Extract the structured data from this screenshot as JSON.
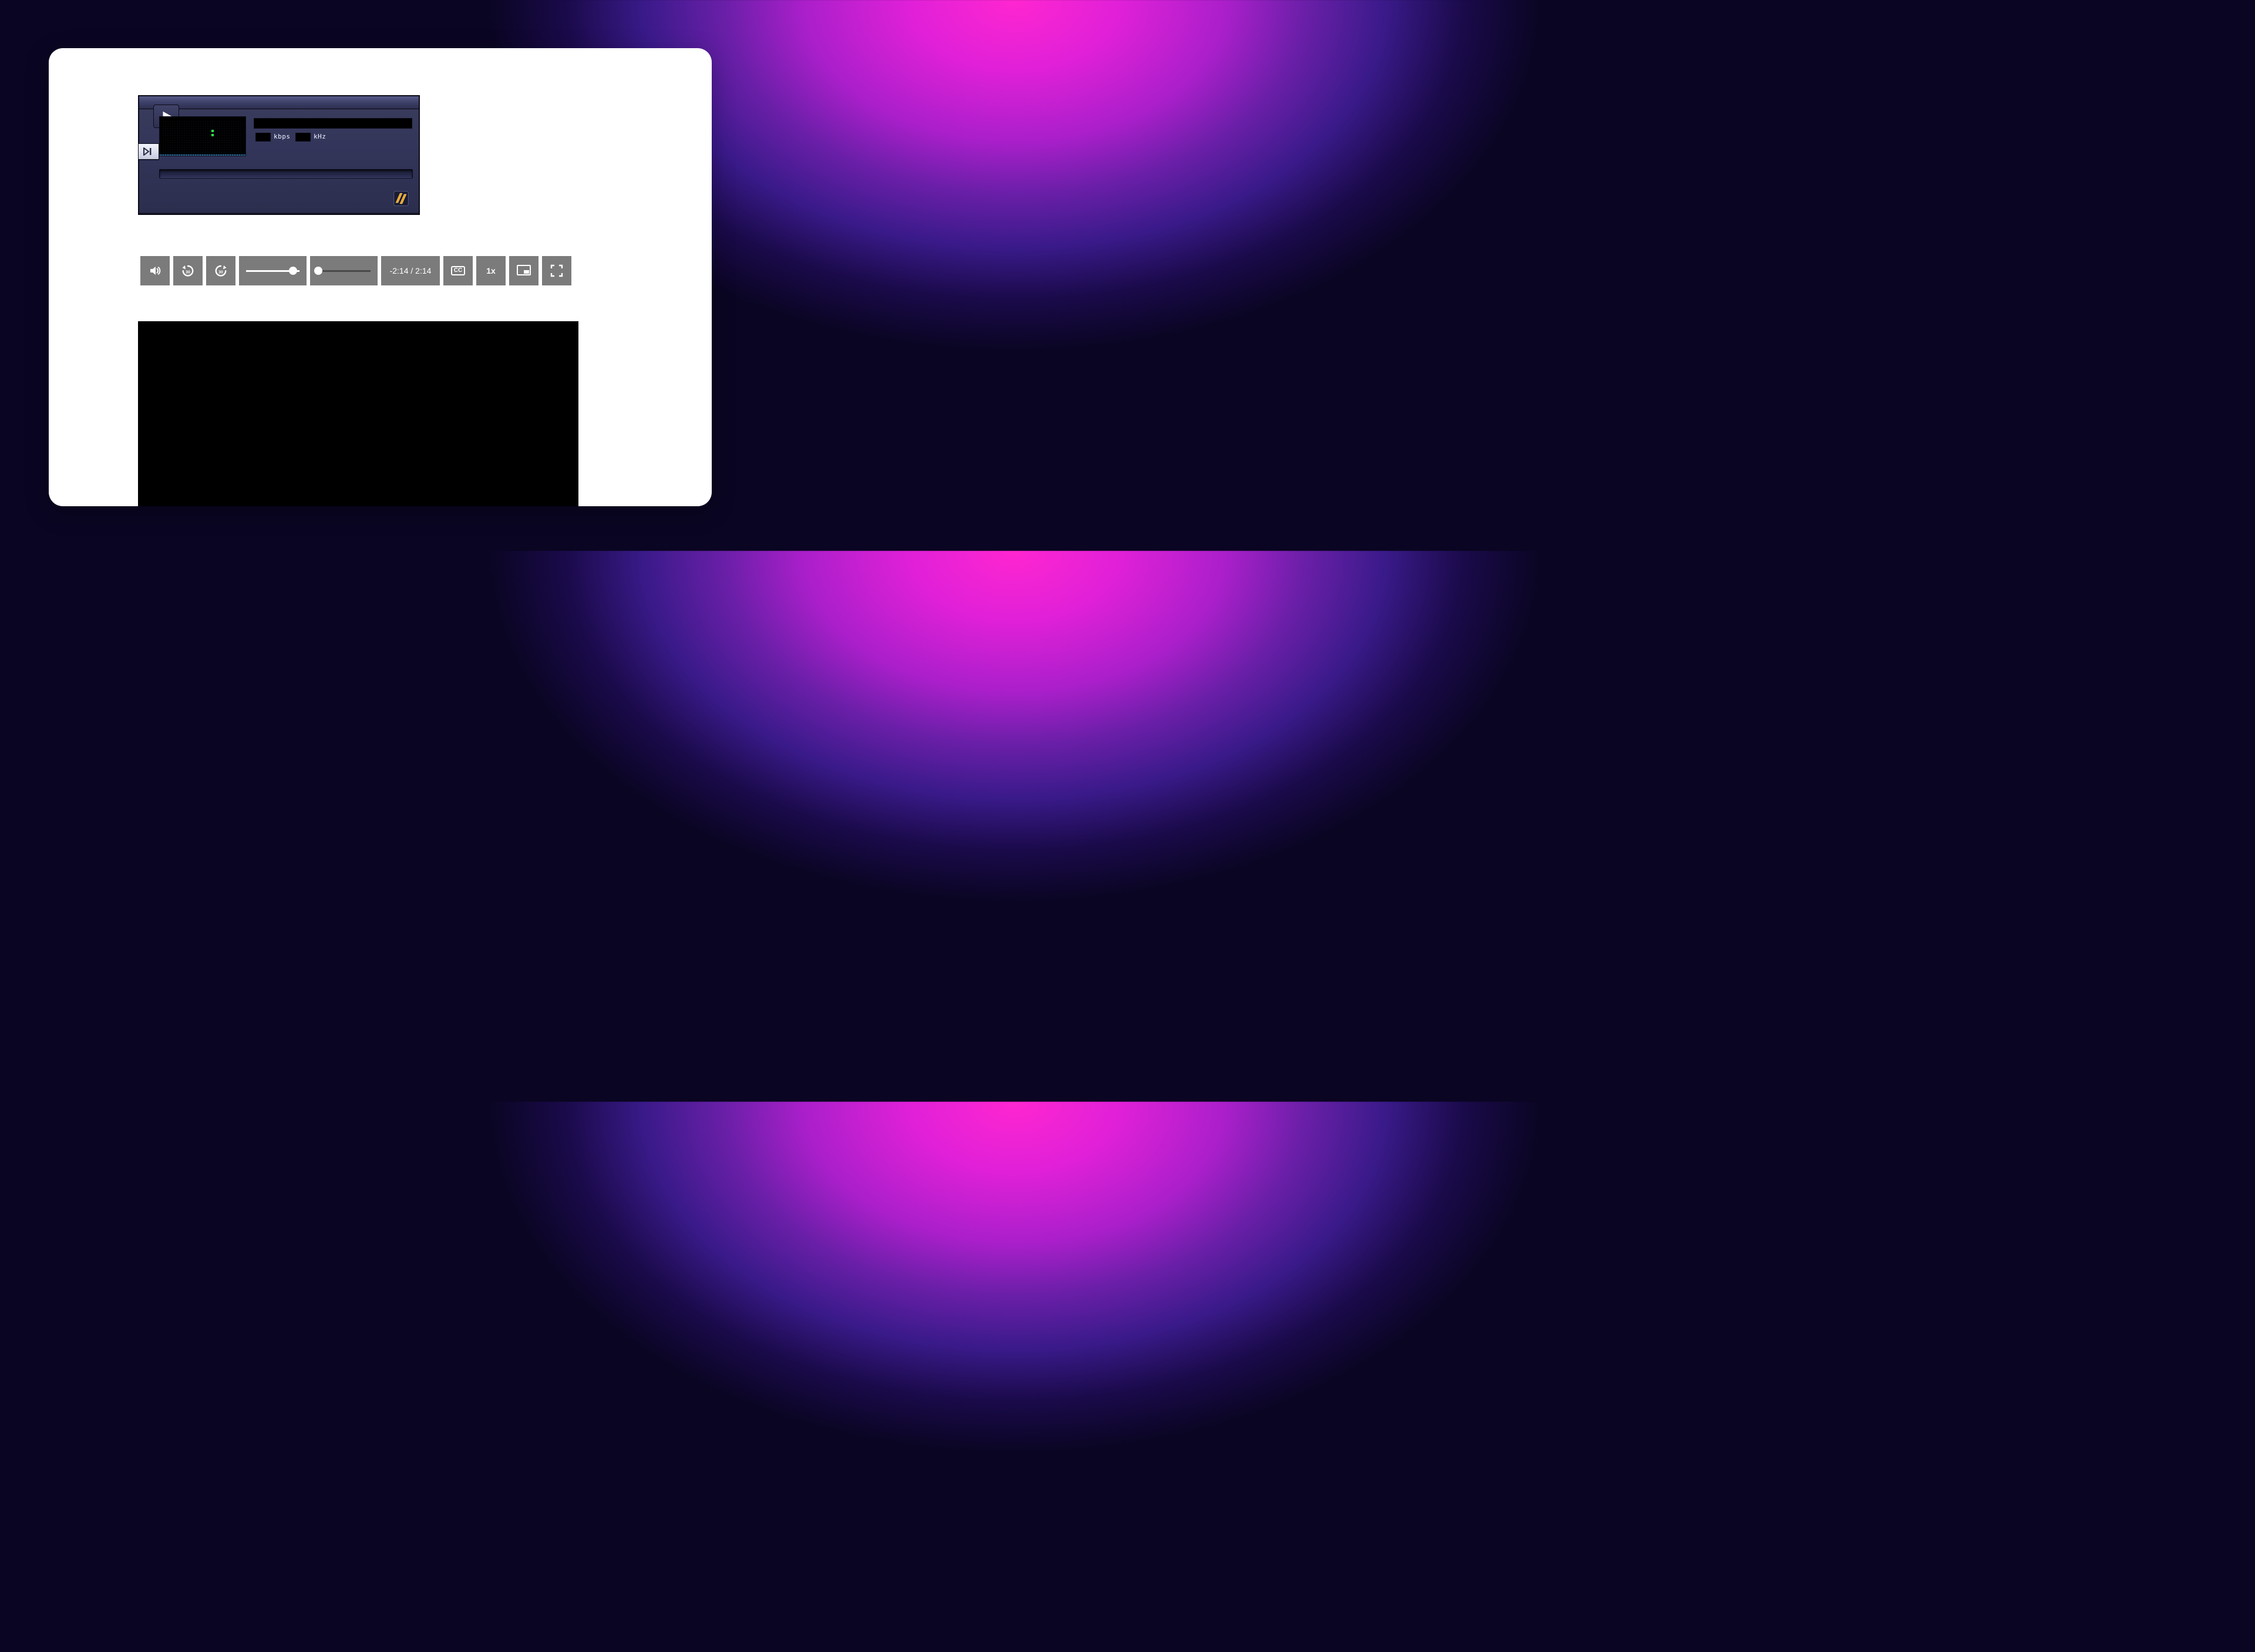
{
  "winamp": {
    "kbps_label": "kbps",
    "khz_label": "kHz"
  },
  "controls": {
    "skip_back_seconds": "30",
    "skip_fwd_seconds": "30",
    "time_text": "-2:14 / 2:14",
    "speed_label": "1x",
    "cc_label": "CC",
    "volume_percent": 88,
    "progress_percent": 2
  }
}
